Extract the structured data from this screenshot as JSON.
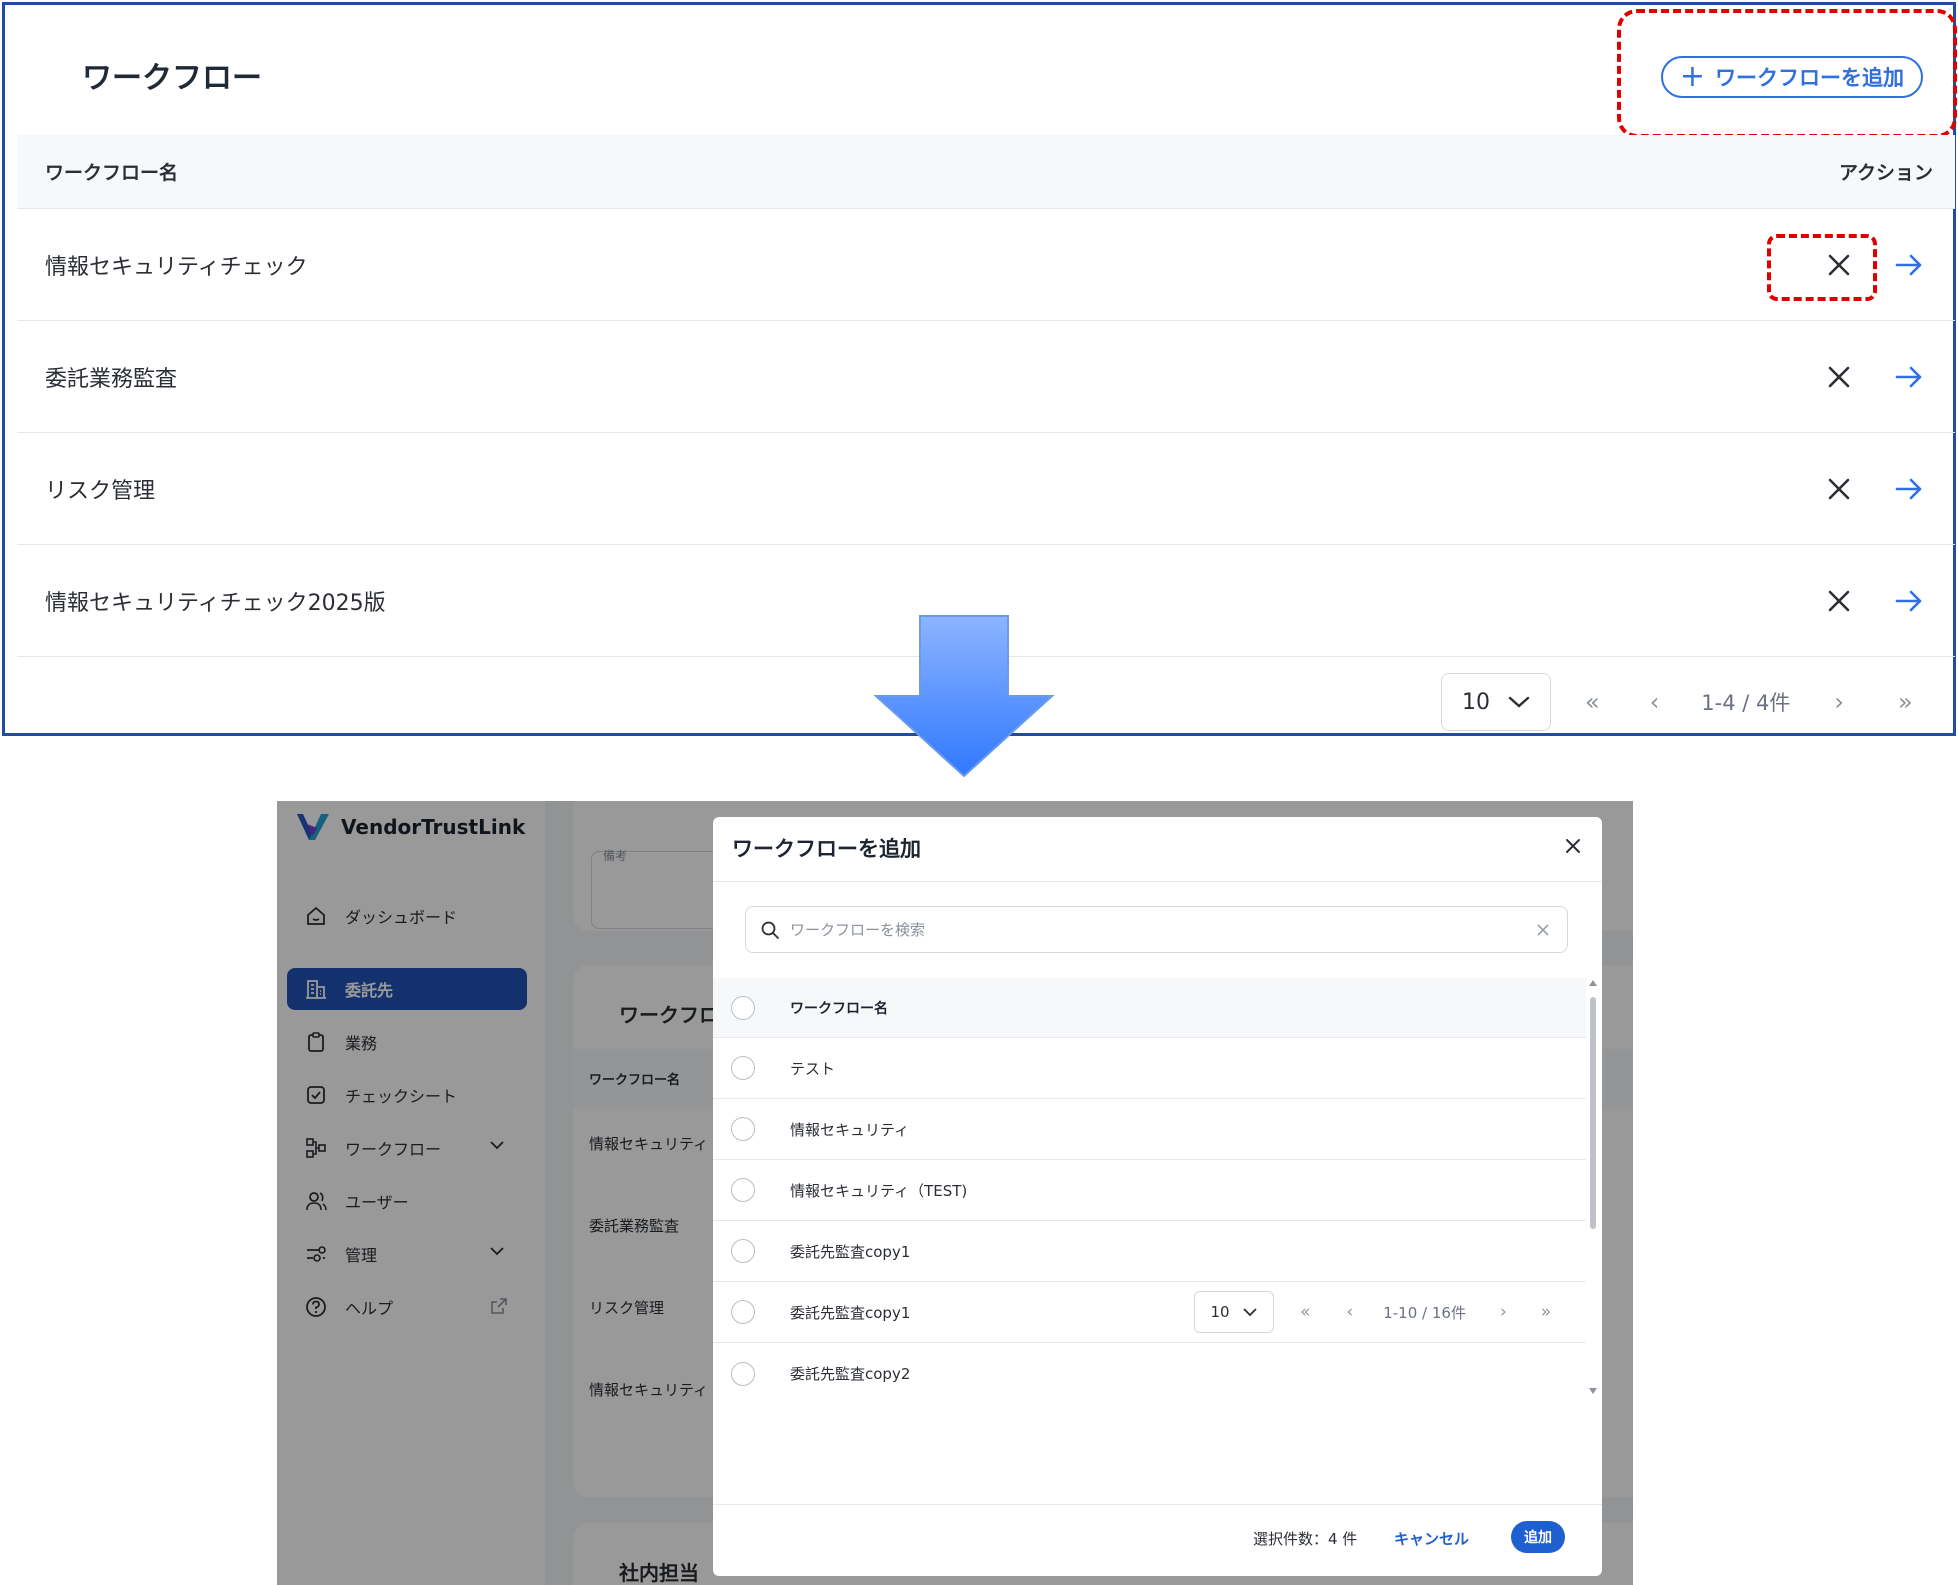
{
  "top": {
    "title": "ワークフロー",
    "add_button": "ワークフローを追加",
    "columns": {
      "name": "ワークフロー名",
      "actions": "アクション"
    },
    "rows": [
      {
        "name": "情報セキュリティチェック"
      },
      {
        "name": "委託業務監査"
      },
      {
        "name": "リスク管理"
      },
      {
        "name": "情報セキュリティチェック2025版"
      }
    ],
    "pagination": {
      "per_page": "10",
      "first": "«",
      "prev": "‹",
      "range": "1-4 / 4件",
      "next": "›",
      "last": "»"
    }
  },
  "app": {
    "brand": "VendorTrustLink",
    "nav": [
      {
        "label": "ダッシュボード",
        "icon": "home-icon",
        "active": false
      },
      {
        "label": "委託先",
        "icon": "building-icon",
        "active": true
      },
      {
        "label": "業務",
        "icon": "clipboard-icon",
        "active": false
      },
      {
        "label": "チェックシート",
        "icon": "checkbox-icon",
        "active": false
      },
      {
        "label": "ワークフロー",
        "icon": "workflow-icon",
        "active": false
      },
      {
        "label": "ユーザー",
        "icon": "users-icon",
        "active": false
      },
      {
        "label": "管理",
        "icon": "settings-icon",
        "active": false
      },
      {
        "label": "ヘルプ",
        "icon": "help-icon",
        "active": false
      }
    ],
    "background": {
      "field_label": "備考",
      "workflow_card_title": "ワークフロー",
      "workflow_col": "ワークフロー名",
      "rows": [
        "情報セキュリティ",
        "委託業務監査",
        "リスク管理",
        "情報セキュリティ"
      ],
      "staff_card_title": "社内担当"
    }
  },
  "modal": {
    "title": "ワークフローを追加",
    "search_placeholder": "ワークフローを検索",
    "column": "ワークフロー名",
    "rows": [
      "テスト",
      "情報セキュリティ",
      "情報セキュリティ（TEST)",
      "委託先監査copy1",
      "委託先監査copy1",
      "委託先監査copy2"
    ],
    "pagination": {
      "per_page": "10",
      "first": "«",
      "prev": "‹",
      "range": "1-10 / 16件",
      "next": "›",
      "last": "»"
    },
    "footer": {
      "selected_count": "選択件数：4 件",
      "cancel": "キャンセル",
      "add": "追加"
    }
  },
  "colors": {
    "accent": "#2f6fe0",
    "highlight": "#e00000",
    "frame": "#1f4e9c",
    "nav_active": "#1f53b6"
  }
}
